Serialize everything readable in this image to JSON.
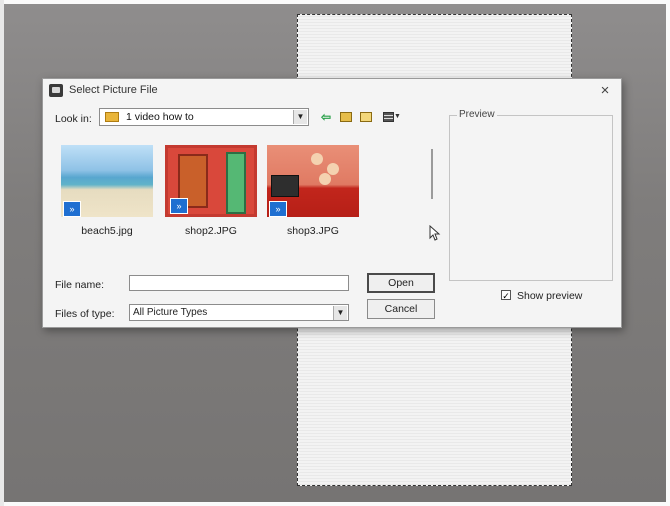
{
  "dialog": {
    "title": "Select Picture File",
    "close_glyph": "×"
  },
  "lookin": {
    "label": "Look in:",
    "value": "1 video how to"
  },
  "files": [
    {
      "name": "beach5.jpg",
      "icon": "shortcut-arrow-icon"
    },
    {
      "name": "shop2.JPG",
      "icon": "shortcut-arrow-icon"
    },
    {
      "name": "shop3.JPG",
      "icon": "shortcut-arrow-icon"
    }
  ],
  "shortcut_glyph": "»",
  "filename": {
    "label": "File name:",
    "value": ""
  },
  "filetype": {
    "label": "Files of type:",
    "value": "All Picture Types"
  },
  "buttons": {
    "open": "Open",
    "cancel": "Cancel"
  },
  "preview": {
    "label": "Preview",
    "show_label": "Show preview",
    "show_checked": true
  },
  "colors": {
    "accent": "#1f6fd1",
    "folder": "#e9b53a"
  }
}
